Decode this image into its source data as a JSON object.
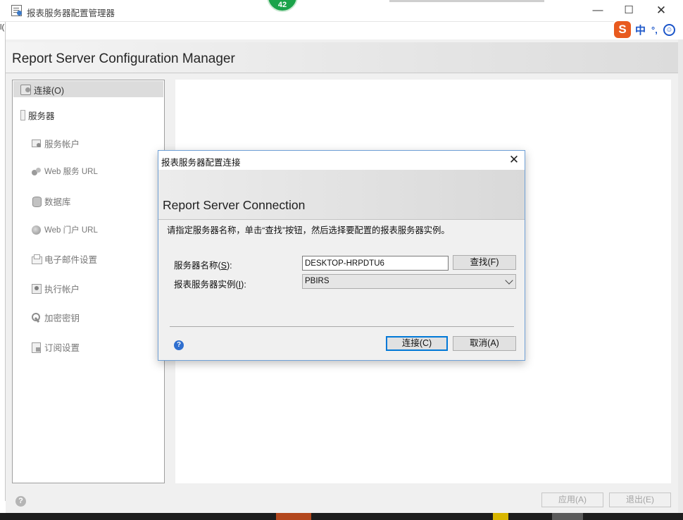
{
  "window": {
    "title": "报表服务器配置管理器",
    "minimize_glyph": "—",
    "maximize_glyph": "☐",
    "close_glyph": "✕",
    "notification_count": "42"
  },
  "ime": {
    "logo": "S",
    "mode": "中",
    "punct": "°,",
    "emoji": "☺"
  },
  "background_fragment": "l(",
  "header": {
    "title": "Report Server Configuration Manager"
  },
  "sidebar": {
    "connect": "连接(O)",
    "server": "服务器",
    "items": [
      {
        "label": "服务帐户",
        "icon": "service-account-icon"
      },
      {
        "label": "Web 服务 URL",
        "icon": "web-service-icon"
      },
      {
        "label": "数据库",
        "icon": "database-icon"
      },
      {
        "label": "Web 门户 URL",
        "icon": "web-portal-icon"
      },
      {
        "label": "电子邮件设置",
        "icon": "email-icon"
      },
      {
        "label": "执行帐户",
        "icon": "execution-account-icon"
      },
      {
        "label": "加密密钥",
        "icon": "key-icon"
      },
      {
        "label": "订阅设置",
        "icon": "subscription-icon"
      }
    ]
  },
  "footer": {
    "help": "?",
    "apply": "应用(A)",
    "exit": "退出(E)"
  },
  "dialog": {
    "title": "报表服务器配置连接",
    "close_glyph": "✕",
    "heading": "Report Server Connection",
    "instruction": "请指定服务器名称，单击“查找”按钮，然后选择要配置的报表服务器实例。",
    "server_name_label": "服务器名称(",
    "server_name_key": "S",
    "server_name_suffix": "):",
    "server_name_value": "DESKTOP-HRPDTU6",
    "find_button": "查找(F)",
    "instance_label": "报表服务器实例(",
    "instance_key": "I",
    "instance_suffix": "):",
    "instance_value": "PBIRS",
    "help": "?",
    "connect_button": "连接(C)",
    "cancel_button": "取消(A)"
  }
}
